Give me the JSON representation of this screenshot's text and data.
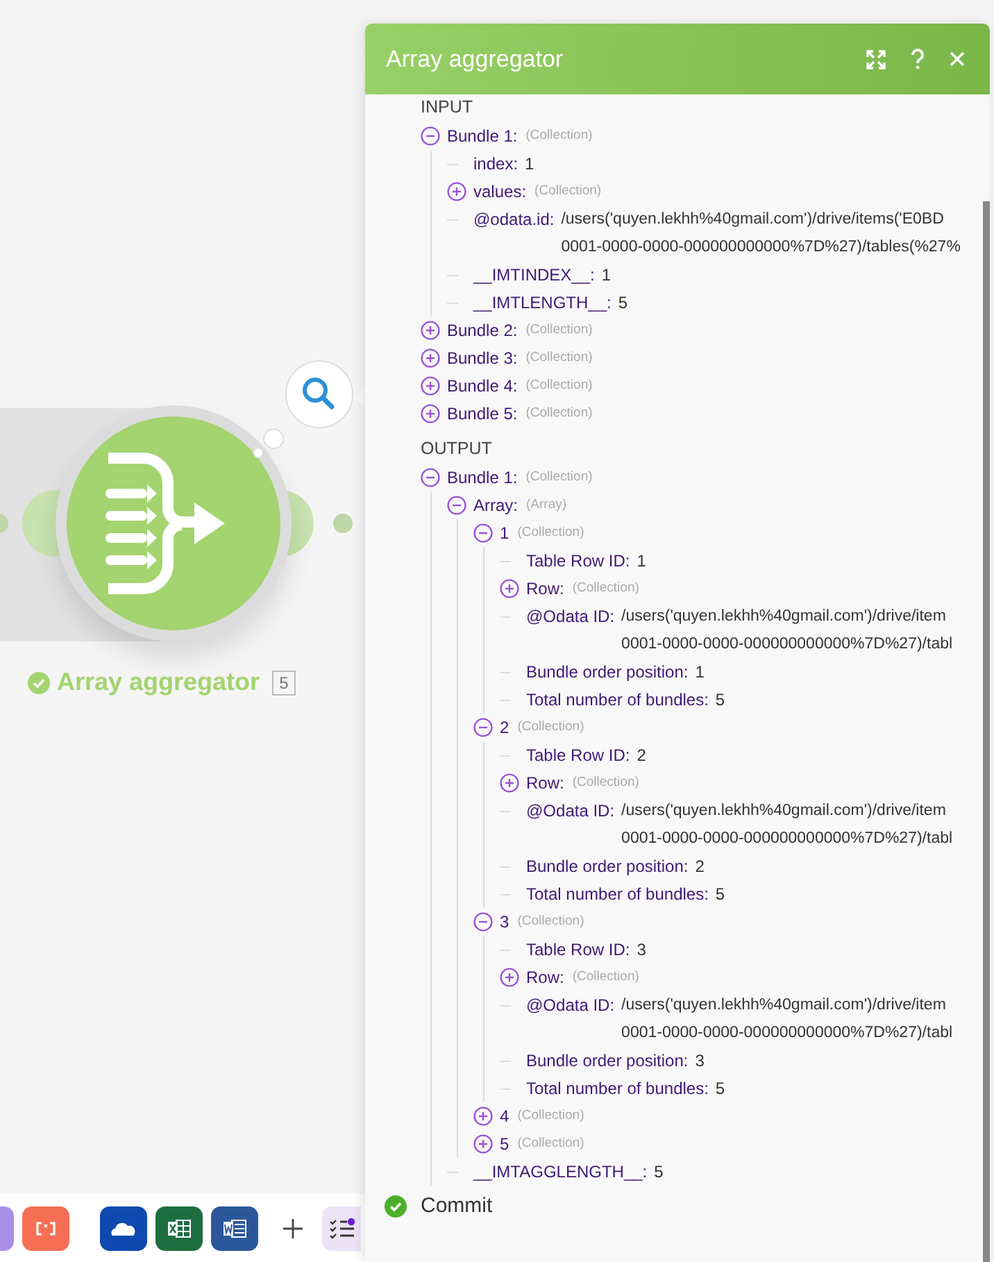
{
  "canvas": {
    "module": {
      "name": "Array aggregator",
      "count": "5"
    }
  },
  "panel": {
    "title": "Array aggregator",
    "sections": [
      {
        "title": "INPUT",
        "items": [
          {
            "key": "Bundle 1:",
            "type": "(Collection)",
            "expanded": true,
            "children": [
              {
                "key": "index:",
                "value": "1"
              },
              {
                "key": "values:",
                "type": "(Collection)",
                "expanded": false
              },
              {
                "key": "@odata.id:",
                "lines": [
                  "/users('quyen.lekhh%40gmail.com')/drive/items('E0BD",
                  "0001-0000-0000-000000000000%7D%27)/tables(%27%"
                ]
              },
              {
                "key": "__IMTINDEX__:",
                "value": "1"
              },
              {
                "key": "__IMTLENGTH__:",
                "value": "5"
              }
            ]
          },
          {
            "key": "Bundle 2:",
            "type": "(Collection)",
            "expanded": false
          },
          {
            "key": "Bundle 3:",
            "type": "(Collection)",
            "expanded": false
          },
          {
            "key": "Bundle 4:",
            "type": "(Collection)",
            "expanded": false
          },
          {
            "key": "Bundle 5:",
            "type": "(Collection)",
            "expanded": false
          }
        ]
      },
      {
        "title": "OUTPUT",
        "items": [
          {
            "key": "Bundle 1:",
            "type": "(Collection)",
            "expanded": true,
            "children": [
              {
                "key": "Array:",
                "type": "(Array)",
                "expanded": true,
                "children": [
                  {
                    "key": "1",
                    "type": "(Collection)",
                    "expanded": true,
                    "children": [
                      {
                        "key": "Table Row ID:",
                        "value": "1"
                      },
                      {
                        "key": "Row:",
                        "type": "(Collection)",
                        "expanded": false
                      },
                      {
                        "key": "@Odata ID:",
                        "lines": [
                          "/users('quyen.lekhh%40gmail.com')/drive/item",
                          "0001-0000-0000-000000000000%7D%27)/tabl"
                        ]
                      },
                      {
                        "key": "Bundle order position:",
                        "value": "1"
                      },
                      {
                        "key": "Total number of bundles:",
                        "value": "5"
                      }
                    ]
                  },
                  {
                    "key": "2",
                    "type": "(Collection)",
                    "expanded": true,
                    "children": [
                      {
                        "key": "Table Row ID:",
                        "value": "2"
                      },
                      {
                        "key": "Row:",
                        "type": "(Collection)",
                        "expanded": false
                      },
                      {
                        "key": "@Odata ID:",
                        "lines": [
                          "/users('quyen.lekhh%40gmail.com')/drive/item",
                          "0001-0000-0000-000000000000%7D%27)/tabl"
                        ]
                      },
                      {
                        "key": "Bundle order position:",
                        "value": "2"
                      },
                      {
                        "key": "Total number of bundles:",
                        "value": "5"
                      }
                    ]
                  },
                  {
                    "key": "3",
                    "type": "(Collection)",
                    "expanded": true,
                    "children": [
                      {
                        "key": "Table Row ID:",
                        "value": "3"
                      },
                      {
                        "key": "Row:",
                        "type": "(Collection)",
                        "expanded": false
                      },
                      {
                        "key": "@Odata ID:",
                        "lines": [
                          "/users('quyen.lekhh%40gmail.com')/drive/item",
                          "0001-0000-0000-000000000000%7D%27)/tabl"
                        ]
                      },
                      {
                        "key": "Bundle order position:",
                        "value": "3"
                      },
                      {
                        "key": "Total number of bundles:",
                        "value": "5"
                      }
                    ]
                  },
                  {
                    "key": "4",
                    "type": "(Collection)",
                    "expanded": false
                  },
                  {
                    "key": "5",
                    "type": "(Collection)",
                    "expanded": false
                  }
                ]
              },
              {
                "key": "__IMTAGGLENGTH__:",
                "value": "5"
              }
            ]
          }
        ]
      }
    ],
    "operations": [
      {
        "label": "Commit"
      }
    ]
  },
  "toolbar": {
    "apps": [
      {
        "kind": "purple"
      },
      {
        "kind": "brackets"
      },
      {
        "kind": "cloud"
      },
      {
        "kind": "sheet"
      },
      {
        "kind": "doc"
      },
      {
        "kind": "plus"
      },
      {
        "kind": "checklist"
      }
    ]
  }
}
